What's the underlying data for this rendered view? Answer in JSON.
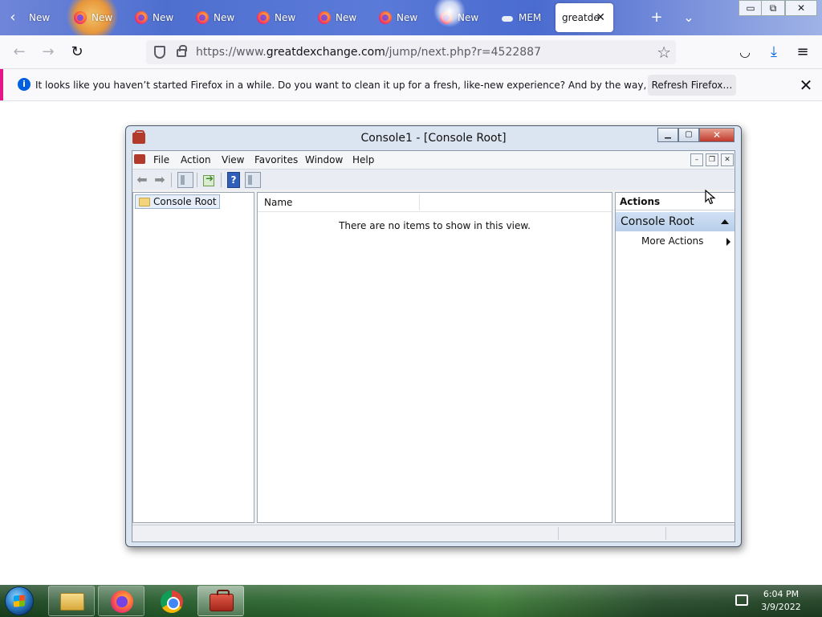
{
  "browser": {
    "tabs": [
      {
        "label": "New",
        "icon": "firefox-icon"
      },
      {
        "label": "New",
        "icon": "firefox-icon"
      },
      {
        "label": "New",
        "icon": "firefox-icon"
      },
      {
        "label": "New",
        "icon": "firefox-icon"
      },
      {
        "label": "New",
        "icon": "firefox-icon"
      },
      {
        "label": "New",
        "icon": "firefox-icon"
      },
      {
        "label": "New",
        "icon": "firefox-icon"
      },
      {
        "label": "New",
        "icon": "firefox-icon"
      },
      {
        "label": "MEM",
        "icon": "cloud-icon"
      }
    ],
    "active_tab": {
      "label": "greatde",
      "close": "✕"
    },
    "new_tab": "+",
    "tab_list": "⌄",
    "window_controls": {
      "minimize": "▭",
      "restore": "⧉",
      "close": "✕"
    },
    "nav": {
      "back": "←",
      "forward": "→",
      "reload": "↻"
    },
    "url": {
      "prefix": "https://www.",
      "host": "greatdexchange.com",
      "path": "/jump/next.php?r=4522887"
    },
    "bookmark": "☆",
    "toolbar_right": {
      "pocket": "◡",
      "downloads": "⤓",
      "menu": "≡"
    }
  },
  "notification": {
    "info": "i",
    "message": "It looks like you haven’t started Firefox in a while. Do you want to clean it up for a fresh, like-new experience? And by the way, welcome back!",
    "button": "Refresh Firefox…",
    "close": "✕"
  },
  "console": {
    "title": "Console1 - [Console Root]",
    "window_controls": {
      "minimize": "▁",
      "maximize": "▢",
      "close": "✕"
    },
    "menu": [
      "File",
      "Action",
      "View",
      "Favorites",
      "Window",
      "Help"
    ],
    "mdi_controls": {
      "minimize": "–",
      "restore": "❐",
      "close": "✕"
    },
    "toolbar": {
      "back": "⬅",
      "forward": "➡",
      "help": "?"
    },
    "tree": {
      "root": "Console Root"
    },
    "list": {
      "column_name": "Name",
      "empty_message": "There are no items to show in this view."
    },
    "actions": {
      "header": "Actions",
      "section": "Console Root",
      "item": "More Actions"
    }
  },
  "taskbar": {
    "time": "6:04 PM",
    "date": "3/9/2022",
    "apps": [
      "windows-explorer",
      "firefox",
      "chrome",
      "mmc-toolbox"
    ]
  }
}
